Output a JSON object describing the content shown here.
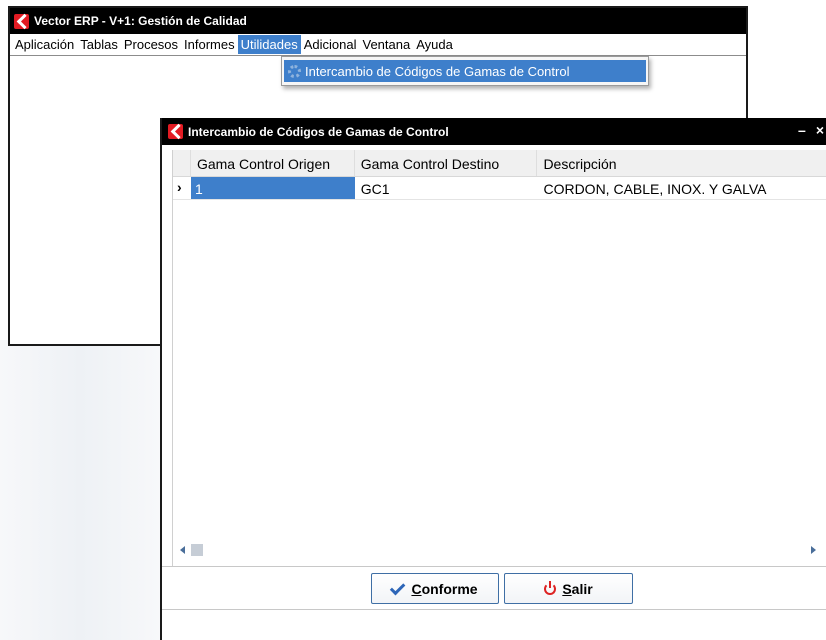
{
  "main_window": {
    "title": "Vector ERP - V+1: Gestión de Calidad",
    "menu": [
      {
        "label": "Aplicación"
      },
      {
        "label": "Tablas"
      },
      {
        "label": "Procesos"
      },
      {
        "label": "Informes"
      },
      {
        "label": "Utilidades",
        "active": true
      },
      {
        "label": "Adicional"
      },
      {
        "label": "Ventana"
      },
      {
        "label": "Ayuda"
      }
    ],
    "dropdown": {
      "item_label": "Intercambio de Códigos de Gamas de Control",
      "item_icon": "gear-icon"
    }
  },
  "dialog": {
    "title": "Intercambio de Códigos de Gamas de Control",
    "minimize_glyph": "–",
    "close_glyph": "×",
    "grid": {
      "columns": [
        "Gama Control Origen",
        "Gama Control Destino",
        "Descripción"
      ],
      "rows": [
        {
          "indicator": "›",
          "origen": "1",
          "destino": "GC1",
          "descripcion": "CORDON, CABLE, INOX. Y GALVA"
        }
      ]
    },
    "buttons": {
      "ok_label": "Conforme",
      "exit_label": "Salir"
    }
  },
  "colors": {
    "accent": "#3e7fcb",
    "titlebar": "#000000",
    "logo": "#e21b23",
    "exit_icon": "#dd2222"
  }
}
